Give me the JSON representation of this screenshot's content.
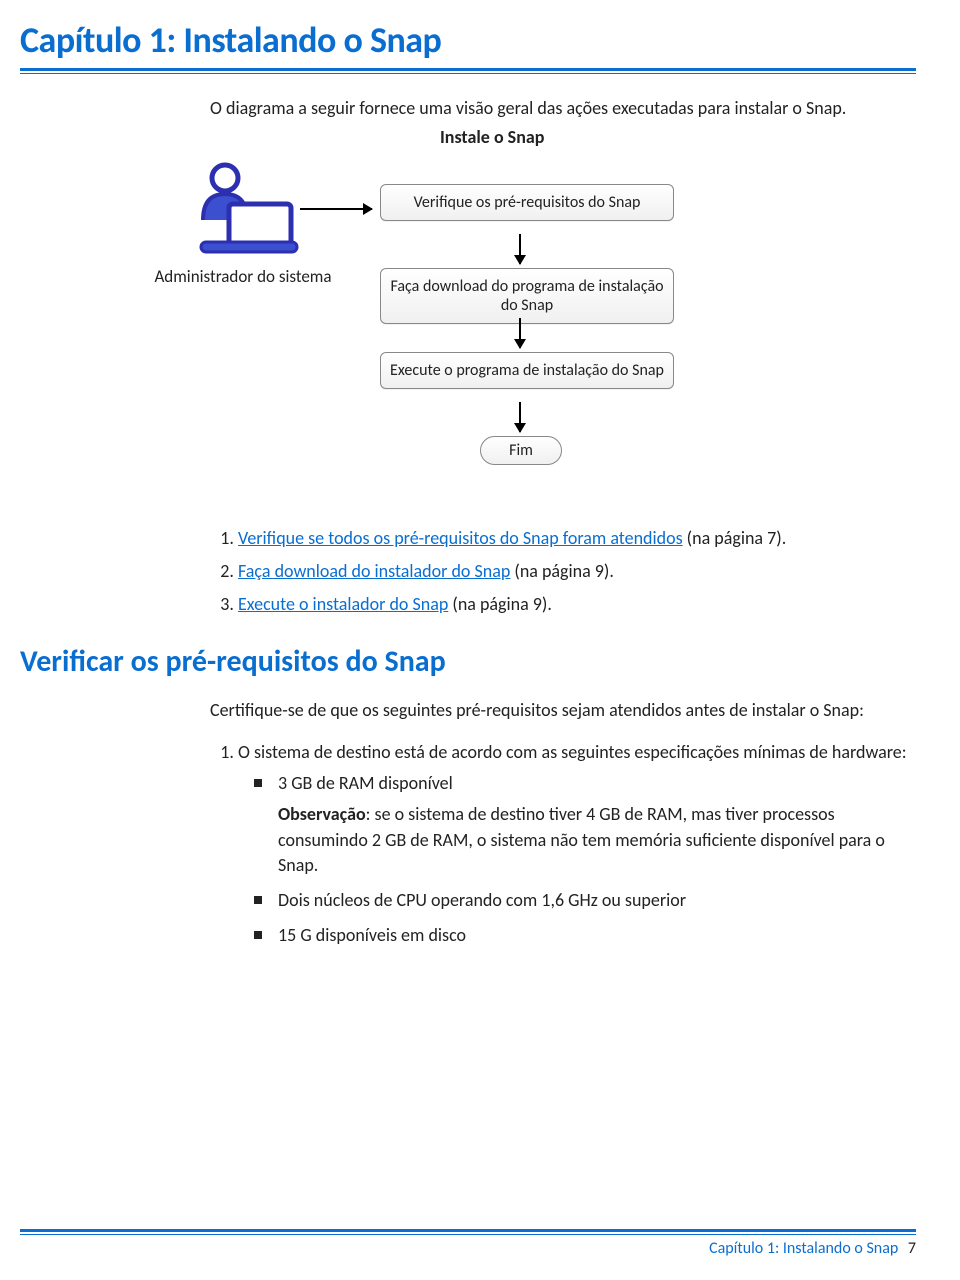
{
  "chapter": {
    "title": "Capítulo 1: Instalando o Snap"
  },
  "intro": "O diagrama a seguir fornece uma visão geral das ações executadas para instalar o Snap.",
  "diagram": {
    "title": "Instale o Snap",
    "actor": "Administrador do sistema",
    "step1": "Verifique os pré-requisitos do Snap",
    "step2": "Faça download do programa de instalação do Snap",
    "step3": "Execute o programa de instalação do Snap",
    "end": "Fim"
  },
  "steps": {
    "n1": "1.",
    "s1_link": "Verifique se todos os pré-requisitos do Snap foram atendidos",
    "s1_suffix": " (na página 7).",
    "n2": "2.",
    "s2_link": "Faça download do instalador do Snap",
    "s2_suffix": " (na página 9).",
    "n3": "3.",
    "s3_link": "Execute o instalador do Snap",
    "s3_suffix": " (na página 9)."
  },
  "section2": {
    "heading": "Verificar os pré-requisitos do Snap",
    "lead": "Certifique-se de que os seguintes pré-requisitos sejam atendidos antes de instalar o Snap:",
    "item1": "O sistema de destino está de acordo com as seguintes especificações mínimas de hardware:",
    "bullet1": "3 GB de RAM disponível",
    "note_label": "Observação",
    "note_text": ": se o sistema de destino tiver 4 GB de RAM, mas tiver processos consumindo 2 GB de RAM, o sistema não tem memória suficiente disponível para o Snap.",
    "bullet2": "Dois núcleos de CPU operando com 1,6 GHz ou superior",
    "bullet3": "15 G disponíveis em disco"
  },
  "footer": {
    "chapter": "Capítulo 1: Instalando o Snap",
    "page": "7"
  }
}
